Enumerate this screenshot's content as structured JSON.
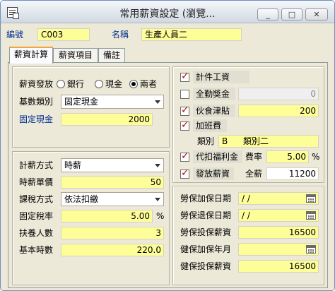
{
  "window": {
    "title": "常用薪資設定 (瀏覽...",
    "min": "_",
    "max": "□",
    "close": "✕"
  },
  "header": {
    "code_label": "編號",
    "code_value": "C003",
    "name_label": "名稱",
    "name_value": "生產人員二"
  },
  "tabs": [
    {
      "label": "薪資計算"
    },
    {
      "label": "薪資項目"
    },
    {
      "label": "備註"
    }
  ],
  "left_top": {
    "payment_label": "薪資發放",
    "payment_options": [
      "銀行",
      "現金",
      "兩者"
    ],
    "payment_selected": "兩者",
    "base_type_label": "基數類別",
    "base_type_value": "固定現金",
    "fixed_cash_label": "固定現金",
    "fixed_cash_value": "2000"
  },
  "left_bottom": {
    "calc_method_label": "計薪方式",
    "calc_method_value": "時薪",
    "hourly_price_label": "時薪單價",
    "hourly_price_value": "50",
    "tax_method_label": "課稅方式",
    "tax_method_value": "依法扣繳",
    "fixed_tax_rate_label": "固定稅率",
    "fixed_tax_rate_value": "5.00",
    "percent": "%",
    "dependents_label": "扶養人數",
    "dependents_value": "3",
    "base_hours_label": "基本時數",
    "base_hours_value": "220.0"
  },
  "right_top": {
    "piece_wage_label": "計件工資",
    "piece_wage_checked": true,
    "attendance_bonus_label": "全勤獎金",
    "attendance_bonus_checked": false,
    "attendance_bonus_value": "0",
    "meal_allowance_label": "伙食津貼",
    "meal_allowance_checked": true,
    "meal_allowance_value": "200",
    "overtime_label": "加班費",
    "overtime_checked": true,
    "category_label": "類別",
    "category_code": "B",
    "category_name": "類別二",
    "welfare_label": "代扣福利金",
    "welfare_checked": true,
    "welfare_rate_label": "費率",
    "welfare_rate_value": "5.00",
    "welfare_percent": "%",
    "payout_label": "發放薪資",
    "payout_checked": true,
    "full_pay_label": "全薪",
    "full_pay_value": "11200"
  },
  "right_bottom": {
    "labor_join_label": "勞保加保日期",
    "labor_join_value": "/ /",
    "labor_leave_label": "勞保退保日期",
    "labor_leave_value": "/ /",
    "labor_salary_label": "勞保投保薪資",
    "labor_salary_value": "16500",
    "health_join_label": "健保加保年月",
    "health_join_value": "",
    "health_salary_label": "健保投保薪資",
    "health_salary_value": "16500"
  },
  "colors": {
    "field_bg": "#fefe99",
    "label_blue": "#002f8f",
    "check_red": "#b01010",
    "tab_accent": "#f2a53a"
  }
}
